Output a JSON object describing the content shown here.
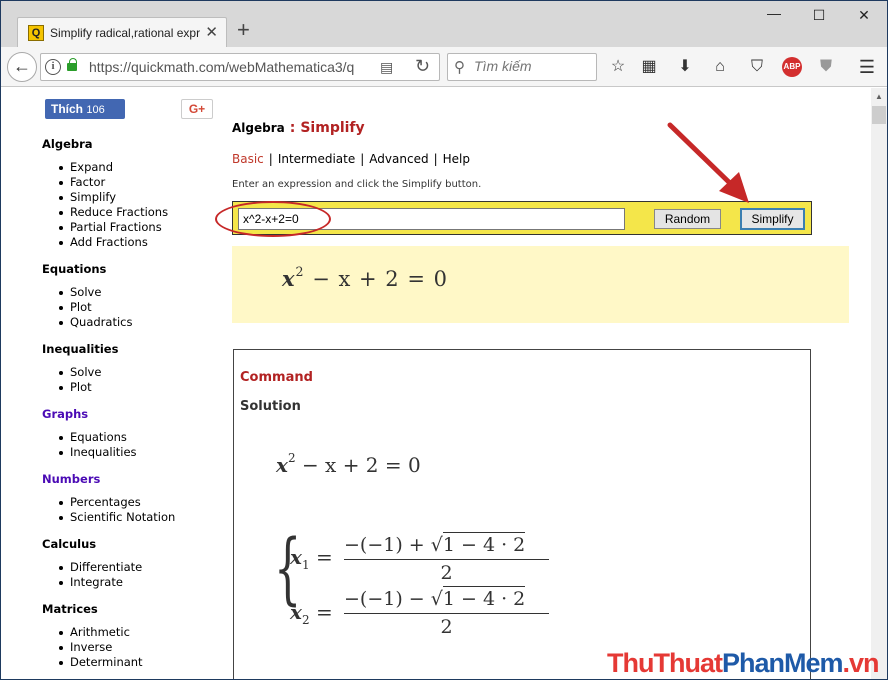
{
  "browser": {
    "tab_title": "Simplify radical,rational expr",
    "tab_favicon": "Q",
    "tab_close": "✕",
    "new_tab": "+",
    "window_controls": {
      "minimize": "—",
      "maximize": "☐",
      "close": "✕"
    },
    "url": "https://quickmath.com/webMathematica3/q",
    "search_placeholder": "Tìm kiếm",
    "toolbar_icons": [
      "star-icon",
      "reading-list-icon",
      "download-icon",
      "home-icon",
      "pocket-icon",
      "adblock-icon",
      "shield-icon",
      "menu-icon"
    ],
    "adblock_label": "ABP"
  },
  "social": {
    "facebook_label": "Thích",
    "facebook_count": "106",
    "gplus_label": "G+"
  },
  "sidebar": [
    {
      "title": "Algebra",
      "color": "black",
      "items": [
        "Expand",
        "Factor",
        "Simplify",
        "Reduce Fractions",
        "Partial Fractions",
        "Add Fractions"
      ]
    },
    {
      "title": "Equations",
      "color": "black",
      "items": [
        "Solve",
        "Plot",
        "Quadratics"
      ]
    },
    {
      "title": "Inequalities",
      "color": "black",
      "items": [
        "Solve",
        "Plot"
      ]
    },
    {
      "title": "Graphs",
      "color": "purple",
      "items": [
        "Equations",
        "Inequalities"
      ]
    },
    {
      "title": "Numbers",
      "color": "purple",
      "items": [
        "Percentages",
        "Scientific Notation"
      ]
    },
    {
      "title": "Calculus",
      "color": "black",
      "items": [
        "Differentiate",
        "Integrate"
      ]
    },
    {
      "title": "Matrices",
      "color": "black",
      "items": [
        "Arithmetic",
        "Inverse",
        "Determinant"
      ]
    }
  ],
  "main": {
    "breadcrumb_section": "Algebra",
    "breadcrumb_sep": ":",
    "breadcrumb_page": "Simplify",
    "modes": [
      "Basic",
      "Intermediate",
      "Advanced",
      "Help"
    ],
    "instruction": "Enter an expression and click the Simplify button.",
    "expression_value": "x^2-x+2=0",
    "random_label": "Random",
    "simplify_label": "Simplify",
    "preview": {
      "lhs": "x",
      "exp": "2",
      "rest": "− x + 2  =  0"
    },
    "result": {
      "command_label": "Command",
      "solution_label": "Solution",
      "equation": {
        "lhs": "x",
        "exp": "2",
        "rest": "− x + 2 = 0"
      },
      "roots": [
        {
          "var": "x",
          "sub": "1",
          "eq": "=",
          "num_prefix": "−(−1) +",
          "radicand": "1 − 4 · 2",
          "den": "2"
        },
        {
          "var": "x",
          "sub": "2",
          "eq": "=",
          "num_prefix": "−(−1) −",
          "radicand": "1 − 4 · 2",
          "den": "2"
        }
      ]
    }
  },
  "watermark": {
    "part1": "ThuThuat",
    "part2": "PhanMem",
    "part3": ".vn"
  },
  "colors": {
    "highlight": "#c62828",
    "input_box": "#f4e64a",
    "preview_bg": "#fff8c7",
    "link_red": "#b22222",
    "section_purple": "#4b0bb5"
  }
}
